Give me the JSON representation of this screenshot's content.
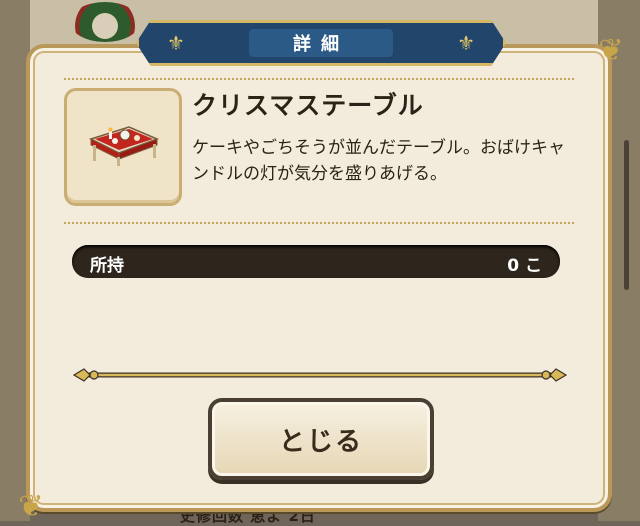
{
  "dialog": {
    "title": "詳細",
    "item": {
      "name": "クリスマステーブル",
      "description": "ケーキやごちそうが並んだテーブル。おばけキャンドルの灯が気分を盛りあげる。",
      "icon": "christmas-table-icon"
    },
    "owned": {
      "label": "所持",
      "value": "0 こ"
    },
    "close_button_label": "とじる"
  },
  "background": {
    "partial_text": "史修回数 恵よ 2日"
  },
  "colors": {
    "banner": "#21456b",
    "gold": "#c9a54a",
    "panel": "#f3ecdc",
    "owned_bar": "#2e261c"
  }
}
